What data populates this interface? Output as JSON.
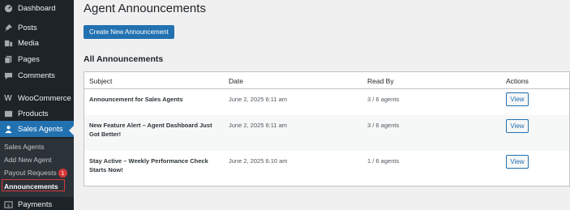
{
  "sidebar": {
    "items": [
      {
        "label": "Dashboard",
        "icon": "dashboard-icon"
      },
      {
        "label": "Posts",
        "icon": "pin-icon"
      },
      {
        "label": "Media",
        "icon": "media-icon"
      },
      {
        "label": "Pages",
        "icon": "pages-icon"
      },
      {
        "label": "Comments",
        "icon": "comment-icon"
      },
      {
        "label": "WooCommerce",
        "icon": "woocommerce-icon"
      },
      {
        "label": "Products",
        "icon": "products-icon"
      },
      {
        "label": "Sales Agents",
        "icon": "users-icon"
      },
      {
        "label": "Payments",
        "icon": "payments-icon"
      }
    ],
    "submenu": [
      {
        "label": "Sales Agents"
      },
      {
        "label": "Add New Agent"
      },
      {
        "label": "Payout Requests",
        "badge": "1"
      },
      {
        "label": "Announcements"
      }
    ]
  },
  "page": {
    "title": "Agent Announcements",
    "create_button": "Create New Announcement",
    "section_title": "All Announcements"
  },
  "table": {
    "headers": {
      "subject": "Subject",
      "date": "Date",
      "read_by": "Read By",
      "actions": "Actions"
    },
    "rows": [
      {
        "subject": "Announcement for Sales Agents",
        "date": "June 2, 2025 6:11 am",
        "read_by": "3 / 6 agents",
        "action": "View"
      },
      {
        "subject": "New Feature Alert – Agent Dashboard Just Got Better!",
        "date": "June 2, 2025 6:11 am",
        "read_by": "3 / 6 agents",
        "action": "View"
      },
      {
        "subject": "Stay Active – Weekly Performance Check Starts Now!",
        "date": "June 2, 2025 6:10 am",
        "read_by": "1 / 6 agents",
        "action": "View"
      }
    ]
  },
  "colors": {
    "accent": "#2271b1",
    "sidebar": "#1d2327",
    "badge": "#d63638"
  }
}
